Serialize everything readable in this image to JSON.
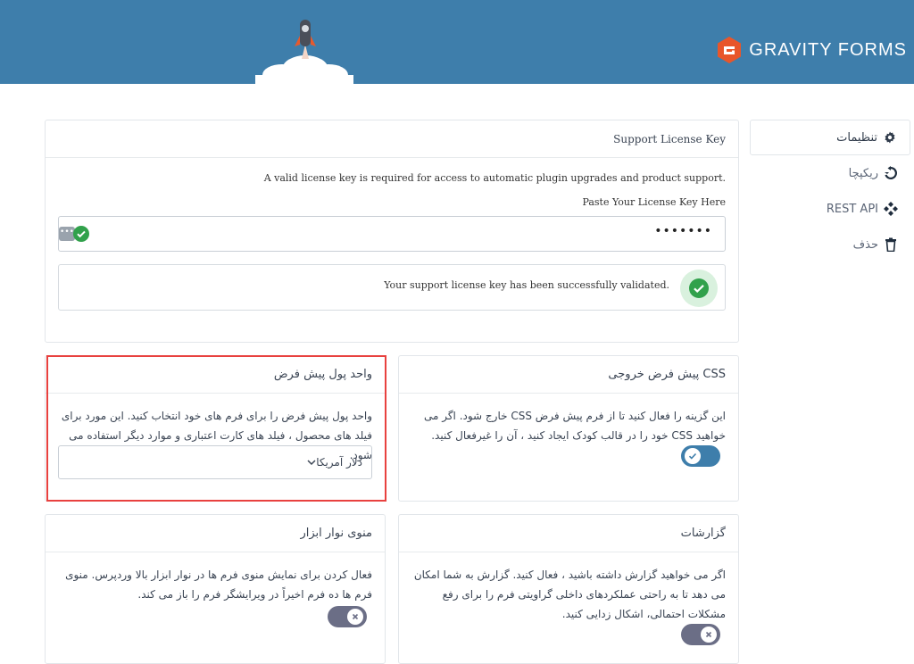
{
  "header": {
    "brand_name": "GRAVITY FORMS",
    "logo_icon": "gravity-forms-logo",
    "mascot_icon": "rocket-icon",
    "bg_color": "#3e7eab"
  },
  "sidebar": {
    "items": [
      {
        "label": "تنظیمات",
        "icon": "gear-icon",
        "active": true
      },
      {
        "label": "ریکپچا",
        "icon": "recaptcha-icon",
        "active": false
      },
      {
        "label": "REST API",
        "icon": "api-icon",
        "active": false
      },
      {
        "label": "حذف",
        "icon": "trash-icon",
        "active": false
      }
    ]
  },
  "license": {
    "title": "Support License Key",
    "description": "A valid license key is required for access to automatic plugin upgrades and product support.",
    "field_label": "Paste Your License Key Here",
    "field_value": "•••••••",
    "badge_dots": "•••",
    "validated_message": "Your support license key has been successfully validated.",
    "status_color": "#31a14b"
  },
  "currency": {
    "title": "واحد پول پیش فرض",
    "description": "واحد پول پیش فرض را برای فرم های خود انتخاب کنید. این مورد برای فیلد های محصول ، فیلد های کارت اعتباری و موارد دیگر استفاده می شود.",
    "selected": "دلار آمریکا",
    "highlight_color": "#e8413f"
  },
  "css_output": {
    "title": "CSS پیش فرض خروجی",
    "description": "این گزینه را فعال کنید تا از فرم پیش فرض CSS خارج شود. اگر می خواهید CSS خود را در قالب کودک ایجاد کنید ، آن را غیرفعال کنید.",
    "toggle_on": true
  },
  "toolbar_menu": {
    "title": "منوی نوار ابزار",
    "description": "فعال کردن برای نمایش منوی فرم ها در نوار ابزار بالا وردپرس. منوی فرم ها ده فرم اخیراً در ویرایشگر فرم را باز می کند.",
    "toggle_on": false
  },
  "reports": {
    "title": "گزارشات",
    "description": "اگر می خواهید گزارش داشته باشید ، فعال کنید. گزارش به شما امکان می دهد تا به راحتی عملکردهای داخلی گراویتی فرم را برای رفع مشکلات احتمالی، اشکال زدایی کنید.",
    "toggle_on": false
  }
}
